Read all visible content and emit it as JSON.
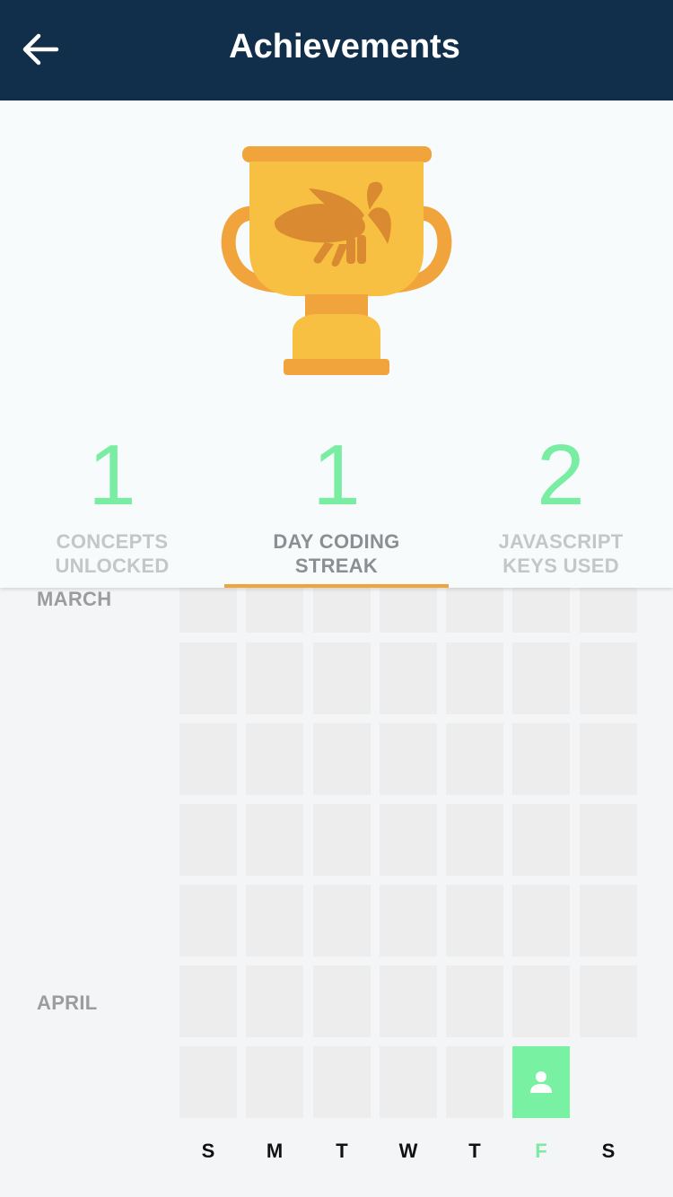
{
  "header": {
    "title": "Achievements",
    "back_icon": "arrow-left-icon",
    "background": "#112f4a"
  },
  "trophy": {
    "icon": "trophy-grasshopper-icon",
    "colors": {
      "cup": "#f7c042",
      "handles": "#f1a43b",
      "emblem": "#da8a30"
    }
  },
  "stats": [
    {
      "number": "1",
      "label_line1": "CONCEPTS",
      "label_line2": "UNLOCKED",
      "active": false
    },
    {
      "number": "1",
      "label_line1": "DAY CODING",
      "label_line2": "STREAK",
      "active": true
    },
    {
      "number": "2",
      "label_line1": "JAVASCRIPT",
      "label_line2": "KEYS USED",
      "active": false
    }
  ],
  "calendar": {
    "months": [
      "MARCH",
      "APRIL"
    ],
    "weekdays": [
      "S",
      "M",
      "T",
      "W",
      "T",
      "F",
      "S"
    ],
    "today_weekday_index": 5,
    "active_day_icon": "person-icon",
    "colors": {
      "accent": "#79eea3",
      "empty_cell": "#ededee",
      "underline": "#f1a43b"
    }
  }
}
